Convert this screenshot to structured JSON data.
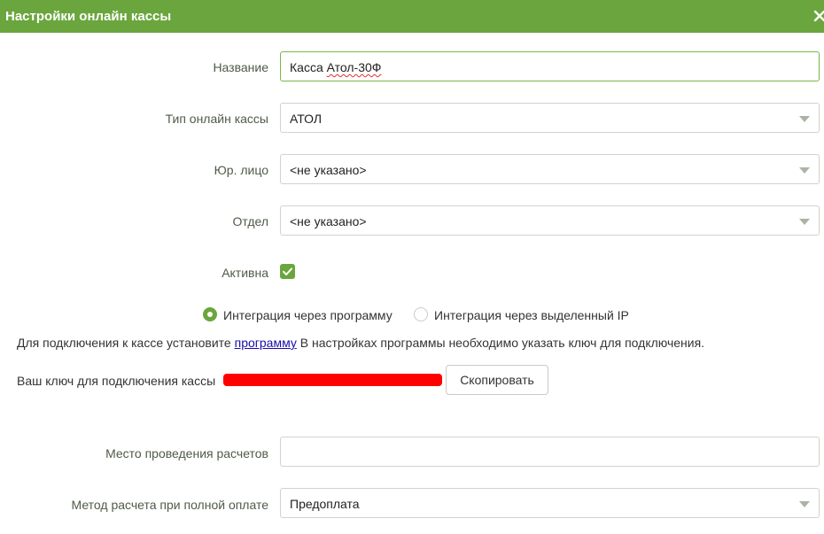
{
  "dialog": {
    "title": "Настройки онлайн кассы",
    "close_glyph": "✕"
  },
  "fields": {
    "name": {
      "label": "Название",
      "value_prefix": "Касса ",
      "value_misspelled": "Атол-30Ф"
    },
    "type": {
      "label": "Тип онлайн кассы",
      "value": "АТОЛ"
    },
    "legal_entity": {
      "label": "Юр. лицо",
      "value": "<не указано>"
    },
    "department": {
      "label": "Отдел",
      "value": "<не указано>"
    },
    "active": {
      "label": "Активна",
      "checked": true
    },
    "settlement_place": {
      "label": "Место проведения расчетов",
      "value": ""
    },
    "payment_method": {
      "label": "Метод расчета при полной оплате",
      "value": "Предоплата"
    }
  },
  "integration": {
    "options": [
      {
        "label": "Интеграция через программу",
        "selected": true
      },
      {
        "label": "Интеграция через выделенный IP",
        "selected": false
      }
    ],
    "info_before": "Для подключения к кассе установите ",
    "info_link": "программу",
    "info_after": " В настройках программы необходимо указать ключ для подключения.",
    "key_label": "Ваш ключ для подключения кассы",
    "copy_button": "Скопировать"
  },
  "colors": {
    "header_bg": "#6aa63d",
    "accent": "#6aa63d",
    "focused_border": "#7ab648",
    "redaction": "#ff0000",
    "link": "#1a0dab"
  }
}
